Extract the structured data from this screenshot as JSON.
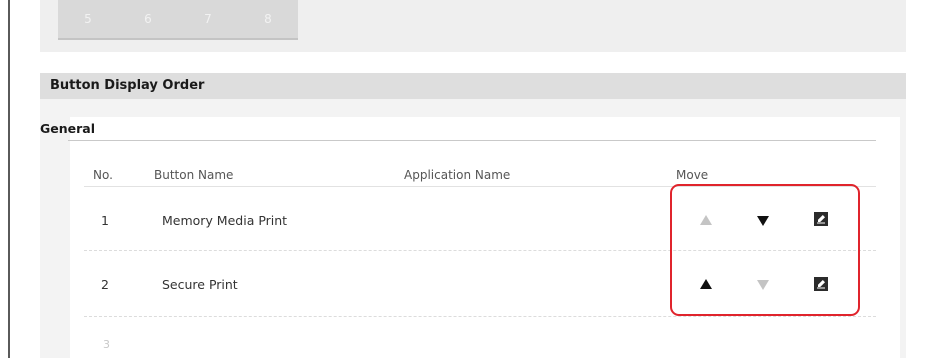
{
  "tabs": [
    "5",
    "6",
    "7",
    "8"
  ],
  "section": {
    "title": "Button Display Order"
  },
  "group": {
    "title": "General"
  },
  "columns": {
    "no": "No.",
    "button_name": "Button Name",
    "application_name": "Application Name",
    "move": "Move"
  },
  "rows": [
    {
      "no": "1",
      "button_name": "Memory Media Print",
      "application_name": "",
      "up_enabled": false,
      "down_enabled": true
    },
    {
      "no": "2",
      "button_name": "Secure Print",
      "application_name": "",
      "up_enabled": true,
      "down_enabled": false
    }
  ],
  "partial_row": {
    "no": "3"
  },
  "icons": {
    "move_up": "triangle-up-icon",
    "move_down": "triangle-down-icon",
    "edit": "edit-icon"
  },
  "colors": {
    "highlight": "#e0242c",
    "enabled_arrow": "#111111",
    "disabled_arrow": "#bdbdbd"
  }
}
